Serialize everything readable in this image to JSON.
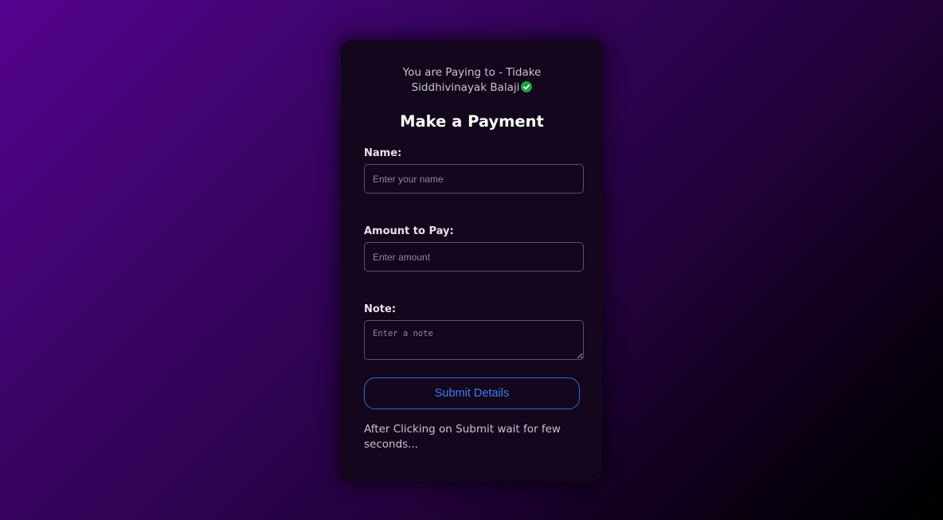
{
  "header": {
    "paying_to": "You are Paying to - Tidake Siddhivinayak Balaji",
    "verified_icon": "check-circle-icon",
    "verified_color": "#1fa33a"
  },
  "form": {
    "title": "Make a Payment",
    "name_label": "Name:",
    "name_placeholder": "Enter your name",
    "name_value": "",
    "amount_label": "Amount to Pay:",
    "amount_placeholder": "Enter amount",
    "amount_value": "",
    "note_label": "Note:",
    "note_placeholder": "Enter a note",
    "note_value": "",
    "submit_label": "Submit Details",
    "after_submit_text": "After Clicking on Submit wait for few seconds..."
  },
  "colors": {
    "accent": "#2a6ce0",
    "card_background": "#14061c",
    "page_gradient_start": "#55038f",
    "page_gradient_end": "#000000"
  }
}
